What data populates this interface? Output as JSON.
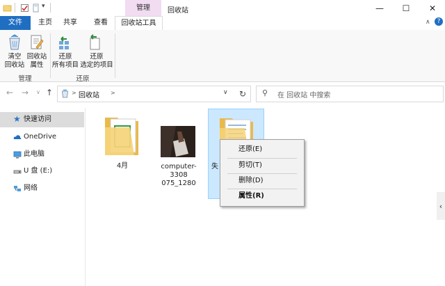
{
  "window": {
    "context_tab_group": "管理",
    "title": "回收站",
    "controls": {
      "minimize": "—",
      "maximize": "☐",
      "close": "✕"
    }
  },
  "tabs": [
    "文件",
    "主页",
    "共享",
    "查看",
    "回收站工具"
  ],
  "ribbon": {
    "groups": [
      {
        "label": "管理",
        "buttons": [
          {
            "line1": "清空",
            "line2": "回收站"
          },
          {
            "line1": "回收站",
            "line2": "属性"
          }
        ]
      },
      {
        "label": "还原",
        "buttons": [
          {
            "line1": "还原",
            "line2": "所有项目"
          },
          {
            "line1": "还原",
            "line2": "选定的项目"
          }
        ]
      }
    ]
  },
  "address": {
    "segments": [
      "回收站"
    ],
    "separator": ">"
  },
  "search": {
    "placeholder": "在 回收站 中搜索"
  },
  "nav": [
    {
      "label": "快速访问",
      "icon": "star-icon",
      "selected": true
    },
    {
      "label": "OneDrive",
      "icon": "cloud-icon"
    },
    {
      "label": "此电脑",
      "icon": "computer-icon"
    },
    {
      "label": "U 盘 (E:)",
      "icon": "usb-drive-icon"
    },
    {
      "label": "网络",
      "icon": "network-icon"
    }
  ],
  "files": [
    {
      "name": "4月",
      "type": "folder"
    },
    {
      "name_line1": "computer-3308",
      "name_line2": "075_1280",
      "type": "image"
    },
    {
      "name": "失",
      "type": "folder",
      "selected": true
    }
  ],
  "context_menu": [
    "还原(E)",
    "剪切(T)",
    "删除(D)",
    "属性(R)"
  ],
  "colors": {
    "file_tab": "#1f6ec2",
    "context_tab": "#f2dcf2",
    "selection": "#cce8ff",
    "folder": "#f6d47a"
  }
}
